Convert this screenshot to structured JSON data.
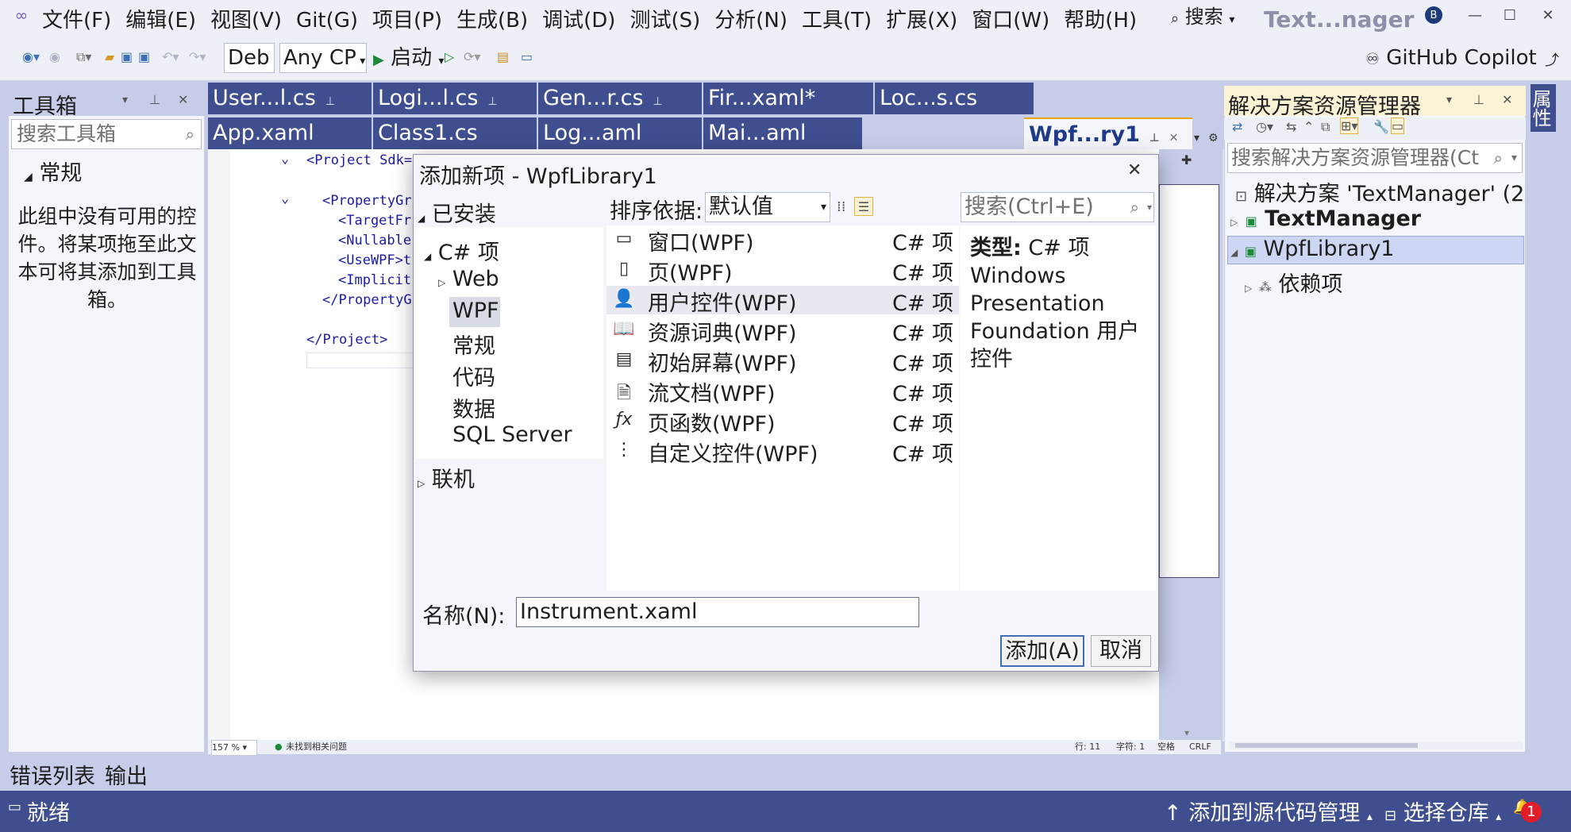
{
  "menu": [
    "文件(F)",
    "编辑(E)",
    "视图(V)",
    "Git(G)",
    "项目(P)",
    "生成(B)",
    "调试(D)",
    "测试(S)",
    "分析(N)",
    "工具(T)",
    "扩展(X)",
    "窗口(W)",
    "帮助(H)"
  ],
  "title": {
    "search": "搜索",
    "app": "Text...nager",
    "avatar": "B"
  },
  "toolbar": {
    "config": "Deb",
    "platform": "Any CP",
    "start": "启动",
    "copilot": "GitHub Copilot"
  },
  "toolbox": {
    "title": "工具箱",
    "search_placeholder": "搜索工具箱",
    "group": "常规",
    "empty": "此组中没有可用的控件。将某项拖至此文本可将其添加到工具箱。"
  },
  "tabs_row1": [
    {
      "label": "User...l.cs",
      "pinned": true
    },
    {
      "label": "Logi...l.cs",
      "pinned": true
    },
    {
      "label": "Gen...r.cs",
      "pinned": true
    },
    {
      "label": "Fir...xaml*",
      "pinned": false
    },
    {
      "label": "Loc...s.cs",
      "pinned": false
    }
  ],
  "tabs_row2": [
    {
      "label": "App.xaml"
    },
    {
      "label": "Class1.cs"
    },
    {
      "label": "Log...aml"
    },
    {
      "label": "Mai...aml"
    }
  ],
  "active_tab": "Wpf...ry1",
  "editor": {
    "lines": [
      {
        "text": "<Project Sdk=\"",
        "indent": 0
      },
      {
        "text": "<PropertyGr",
        "indent": 1
      },
      {
        "text": "<TargetFr",
        "indent": 2
      },
      {
        "text": "<Nullable",
        "indent": 2
      },
      {
        "text": "<UseWPF>t",
        "indent": 2
      },
      {
        "text": "<Implicit",
        "indent": 2
      },
      {
        "text": "</PropertyG",
        "indent": 1
      },
      {
        "text": "</Project>",
        "indent": 0
      }
    ],
    "zoom": "157 %",
    "issues": "未找到相关问题",
    "line": "行: 11",
    "char": "字符: 1",
    "spaces": "空格",
    "eol": "CRLF"
  },
  "solution": {
    "title": "解决方案资源管理器",
    "search_placeholder": "搜索解决方案资源管理器(Ct",
    "items": [
      {
        "label": "解决方案 'TextManager' (2",
        "level": 0
      },
      {
        "label": "TextManager",
        "level": 1,
        "bold": true
      },
      {
        "label": "WpfLibrary1",
        "level": 1,
        "selected": true
      },
      {
        "label": "依赖项",
        "level": 2
      }
    ]
  },
  "properties_label": "属性",
  "bottom": {
    "errors": "错误列表",
    "output": "输出",
    "status": "就绪",
    "add_source": "添加到源代码管理",
    "select_repo": "选择仓库",
    "notifications": "1"
  },
  "dialog": {
    "title": "添加新项 - WpfLibrary1",
    "installed": "已安装",
    "tree": [
      {
        "label": "C# 项",
        "level": 0,
        "expanded": true
      },
      {
        "label": "Web",
        "level": 1,
        "collapsed": true
      },
      {
        "label": "WPF",
        "level": 1,
        "selected": true
      },
      {
        "label": "常规",
        "level": 1
      },
      {
        "label": "代码",
        "level": 1
      },
      {
        "label": "数据",
        "level": 1
      },
      {
        "label": "SQL Server",
        "level": 1
      }
    ],
    "online": "联机",
    "sort_label": "排序依据:",
    "sort_value": "默认值",
    "search_placeholder": "搜索(Ctrl+E)",
    "templates": [
      {
        "name": "窗口(WPF)",
        "type": "C# 项",
        "icon": "window-icon"
      },
      {
        "name": "页(WPF)",
        "type": "C# 项",
        "icon": "page-icon"
      },
      {
        "name": "用户控件(WPF)",
        "type": "C# 项",
        "icon": "user-control-icon",
        "selected": true
      },
      {
        "name": "资源词典(WPF)",
        "type": "C# 项",
        "icon": "dictionary-icon"
      },
      {
        "name": "初始屏幕(WPF)",
        "type": "C# 项",
        "icon": "splash-icon"
      },
      {
        "name": "流文档(WPF)",
        "type": "C# 项",
        "icon": "flow-doc-icon"
      },
      {
        "name": "页函数(WPF)",
        "type": "C# 项",
        "icon": "page-function-icon"
      },
      {
        "name": "自定义控件(WPF)",
        "type": "C# 项",
        "icon": "custom-control-icon"
      }
    ],
    "detail_type_label": "类型:",
    "detail_type_value": "C# 项",
    "detail_desc": "Windows Presentation Foundation 用户控件",
    "name_label": "名称(N):",
    "name_value": "Instrument.xaml",
    "add_button": "添加(A)",
    "cancel_button": "取消"
  }
}
